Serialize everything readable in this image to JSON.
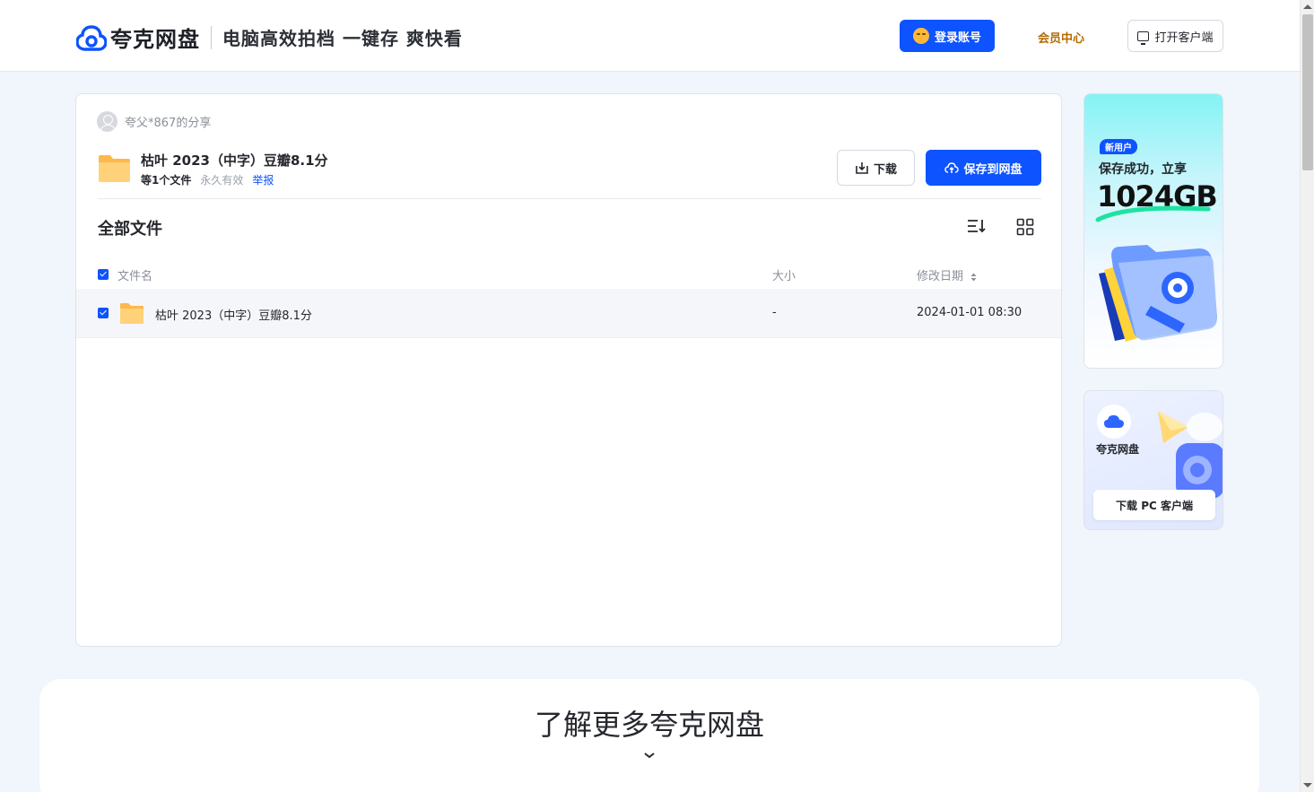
{
  "header": {
    "logo_text": "夸克网盘",
    "slogan": "电脑高效拍档  一键存 爽快看",
    "login_label": "登录账号",
    "vip_label": "会员中心",
    "client_label": "打开客户端"
  },
  "share": {
    "sharer": "夸父*867的分享",
    "title": "枯叶 2023（中字）豆瓣8.1分",
    "file_count": "等1个文件",
    "validity": "永久有效",
    "report": "举报",
    "download_label": "下载",
    "save_label": "保存到网盘"
  },
  "files": {
    "heading": "全部文件",
    "columns": {
      "name": "文件名",
      "size": "大小",
      "date": "修改日期"
    },
    "rows": [
      {
        "name": "枯叶 2023（中字）豆瓣8.1分",
        "size": "-",
        "date": "2024-01-01 08:30"
      }
    ]
  },
  "promo": {
    "badge": "新用户",
    "subtitle": "保存成功，立享",
    "amount": "1024GB",
    "app_name": "夸克网盘",
    "pc_button": "下载 PC 客户端"
  },
  "footer": {
    "learn_more": "了解更多夸克网盘"
  },
  "colors": {
    "accent": "#0d53ff",
    "vip": "#b46a00",
    "folder": "#ffc85c"
  }
}
